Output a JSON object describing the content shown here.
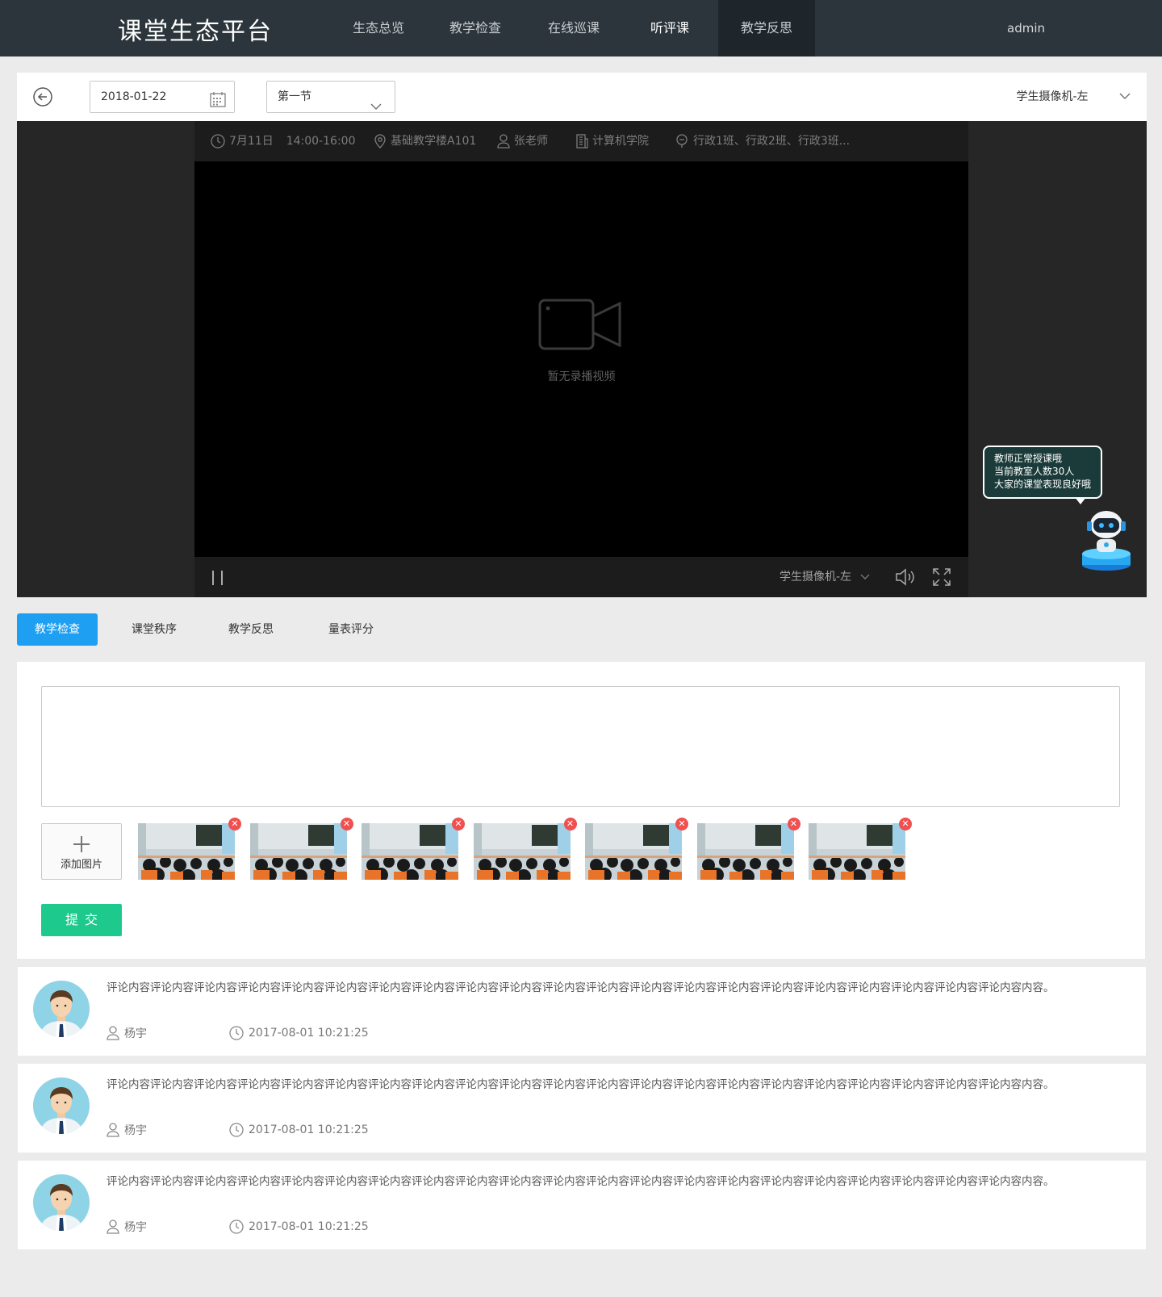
{
  "header": {
    "logo": "课堂生态平台",
    "nav": [
      {
        "label": "生态总览"
      },
      {
        "label": "教学检查"
      },
      {
        "label": "在线巡课"
      },
      {
        "label": "听评课"
      },
      {
        "label": "教学反思"
      }
    ],
    "user": "admin"
  },
  "toolbar": {
    "date_value": "2018-01-22",
    "period_value": "第一节",
    "camera_value": "学生摄像机-左",
    "icons": [
      "back-arrow-icon",
      "calendar-icon",
      "chevron-down-icon"
    ]
  },
  "player": {
    "info": {
      "date": "7月11日",
      "time": "14:00-16:00",
      "location": "基础教学楼A101",
      "teacher": "张老师",
      "college": "计算机学院",
      "classes": "行政1班、行政2班、行政3班..."
    },
    "placeholder": "暂无录播视频",
    "camera_label": "学生摄像机-左",
    "icons": [
      "clock-icon",
      "location-icon",
      "user-icon",
      "building-icon",
      "class-icon",
      "video-camera-icon",
      "pause-icon",
      "volume-icon",
      "fullscreen-icon"
    ]
  },
  "robot": {
    "lines": [
      "教师正常授课哦",
      "当前教室人数30人",
      "大家的课堂表现良好哦"
    ]
  },
  "tabs": [
    {
      "label": "教学检查",
      "active": true
    },
    {
      "label": "课堂秩序",
      "active": false
    },
    {
      "label": "教学反思",
      "active": false
    },
    {
      "label": "量表评分",
      "active": false
    }
  ],
  "form": {
    "textarea_value": "",
    "add_image_label": "添加图片",
    "thumbnail_count": 7,
    "submit_label": "提交"
  },
  "comments": [
    {
      "text": "评论内容评论内容评论内容评论内容评论内容评论内容评论内容评论内容评论内容评论内容评论内容评论内容评论内容评论内容评论内容评论内容评论内容评论内容评论内容评论内容评论内容内容。",
      "author": "杨宇",
      "time": "2017-08-01 10:21:25"
    },
    {
      "text": "评论内容评论内容评论内容评论内容评论内容评论内容评论内容评论内容评论内容评论内容评论内容评论内容评论内容评论内容评论内容评论内容评论内容评论内容评论内容评论内容评论内容内容。",
      "author": "杨宇",
      "time": "2017-08-01 10:21:25"
    },
    {
      "text": "评论内容评论内容评论内容评论内容评论内容评论内容评论内容评论内容评论内容评论内容评论内容评论内容评论内容评论内容评论内容评论内容评论内容评论内容评论内容评论内容评论内容内容。",
      "author": "杨宇",
      "time": "2017-08-01 10:21:25"
    }
  ],
  "colors": {
    "nav_bg": "#2b353b",
    "tab_active": "#1e9ff2",
    "submit": "#1ec98e",
    "delete": "#f0504f"
  }
}
